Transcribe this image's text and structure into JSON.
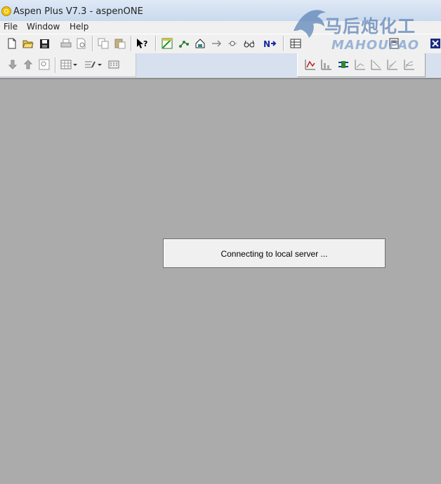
{
  "window": {
    "title": "Aspen Plus V7.3 - aspenONE"
  },
  "menu": {
    "items": [
      "File",
      "Window",
      "Help"
    ]
  },
  "watermark": {
    "chinese_text": "马后炮化工",
    "latin_text": "MAHOUPAO"
  },
  "dialog": {
    "message": "Connecting to local server ..."
  },
  "toolbar": {
    "row1": [
      "new-file-icon",
      "open-folder-icon",
      "save-icon",
      "print-icon",
      "print-preview-icon",
      "copy-icon",
      "paste-icon",
      "whats-this-help-icon",
      "data-browser-icon",
      "flowsheet-icon",
      "model-library-icon",
      "stream-icon",
      "block-icon",
      "glasses-icon",
      "next-icon",
      "results-icon",
      "close-icon"
    ],
    "row2_left": [
      "move-down-icon",
      "move-up-icon",
      "zoom-icon",
      "grid-icon",
      "edit-dropdown-icon",
      "keyboard-icon"
    ],
    "row2_right": [
      "plot-curve-icon",
      "plot-bars-icon",
      "plot-stream-icon",
      "plot-line-icon",
      "plot-triangle-icon",
      "plot-xy-icon",
      "plot-multi-icon"
    ]
  },
  "colors": {
    "workspace_bg": "#ababab",
    "dialog_bg": "#f0f0f0",
    "watermark": "#5f86b8",
    "next_arrow": "#1a2aa0"
  }
}
